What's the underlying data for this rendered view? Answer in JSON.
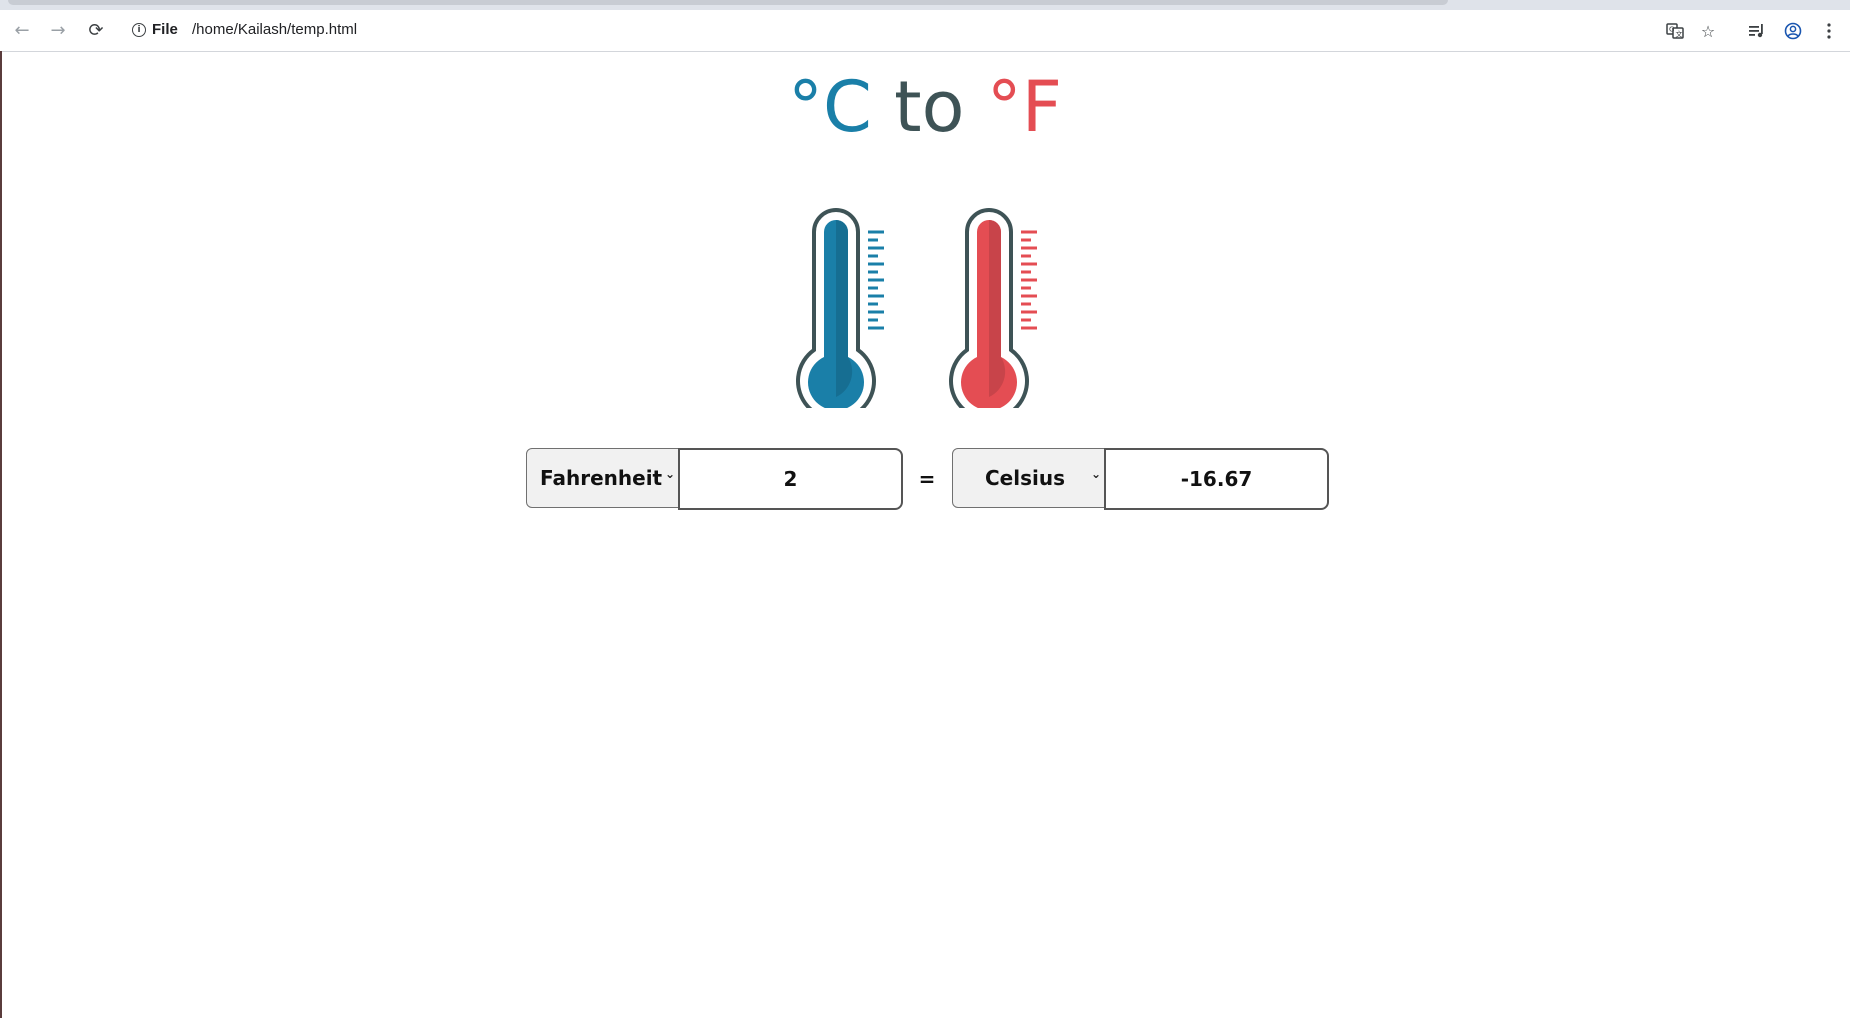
{
  "browser": {
    "url_scheme": "File",
    "url": "/home/Kailash/temp.html",
    "icons": {
      "back": "back-arrow-icon",
      "forward": "forward-arrow-icon",
      "reload": "reload-icon",
      "site_info": "info-icon",
      "translate": "translate-icon",
      "bookmark": "star-icon",
      "media": "media-controls-icon",
      "profile": "profile-icon",
      "menu": "kebab-menu-icon"
    }
  },
  "page": {
    "title_celsius": "°C",
    "title_to": "to",
    "title_fahrenheit": "°F",
    "colors": {
      "celsius_blue": "#1a7fa8",
      "to_gray": "#3e5356",
      "fahrenheit_red": "#e44d53"
    },
    "converter": {
      "from_unit": "Fahrenheit",
      "from_value": "2",
      "equals": "=",
      "to_unit": "Celsius",
      "to_value": "-16.67"
    }
  }
}
